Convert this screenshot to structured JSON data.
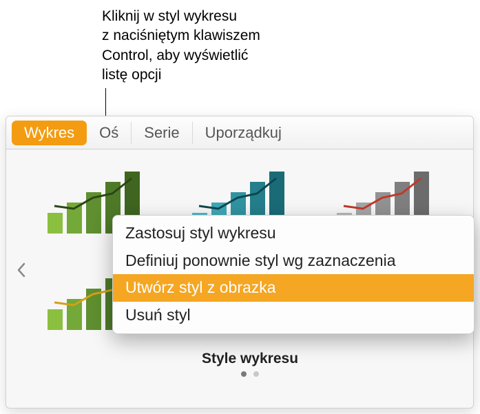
{
  "callout": {
    "text": "Kliknij w styl wykresu\nz naciśniętym klawiszem\nControl, aby wyświetlić\nlistę opcji"
  },
  "tabs": {
    "chart": "Wykres",
    "axis": "Oś",
    "series": "Serie",
    "arrange": "Uporządkuj"
  },
  "section": {
    "title": "Style wykresu"
  },
  "context_menu": {
    "apply": "Zastosuj styl wykresu",
    "redefine": "Definiuj ponownie styl wg zaznaczenia",
    "create": "Utwórz styl z obrazka",
    "delete": "Usuń styl"
  },
  "colors": {
    "tab_active": "#f39c12",
    "menu_highlight": "#f5a623"
  }
}
